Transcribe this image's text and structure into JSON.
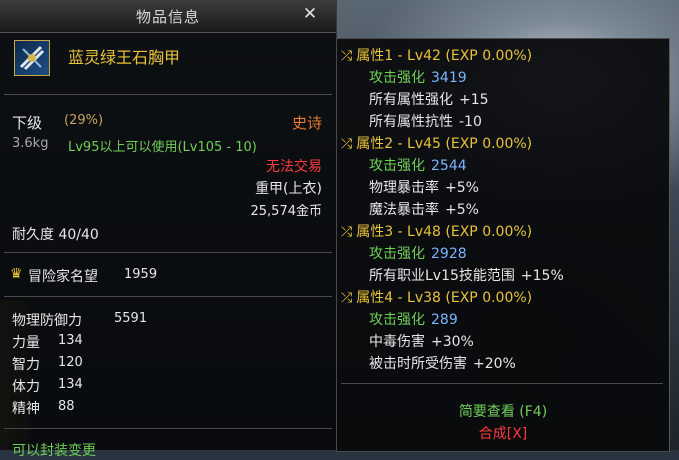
{
  "window": {
    "title": "物品信息"
  },
  "item": {
    "name": "蓝灵绿王石胸甲",
    "grade": "下级",
    "grade_percent": "(29%)",
    "rarity": "史诗",
    "weight": "3.6kg",
    "requirement": "Lv95以上可以使用(Lv105 - 10)",
    "trade": "无法交易",
    "type": "重甲(上衣)",
    "price": "25,574金币",
    "durability": "耐久度 40/40",
    "adventurer_fame_label": "冒险家名望",
    "adventurer_fame_value": "1959",
    "stats": [
      {
        "label": "物理防御力",
        "value": "5591"
      },
      {
        "label": "力量",
        "value": "134"
      },
      {
        "label": "智力",
        "value": "120"
      },
      {
        "label": "体力",
        "value": "134"
      },
      {
        "label": "精神",
        "value": "88"
      }
    ],
    "footer_cut": "可以封装变更"
  },
  "attributes": [
    {
      "header": "属性1 - Lv42 (EXP 0.00%)",
      "lines": [
        {
          "label": "攻击强化",
          "value": "3419",
          "label_color": "green",
          "value_color": "blue"
        },
        {
          "label": "所有属性强化",
          "value": "+15",
          "label_color": "white",
          "value_color": "white"
        },
        {
          "label": "所有属性抗性",
          "value": "-10",
          "label_color": "white",
          "value_color": "white"
        }
      ]
    },
    {
      "header": "属性2 - Lv45 (EXP 0.00%)",
      "lines": [
        {
          "label": "攻击强化",
          "value": "2544",
          "label_color": "green",
          "value_color": "blue"
        },
        {
          "label": "物理暴击率",
          "value": "+5%",
          "label_color": "white",
          "value_color": "white"
        },
        {
          "label": "魔法暴击率",
          "value": "+5%",
          "label_color": "white",
          "value_color": "white"
        }
      ]
    },
    {
      "header": "属性3 - Lv48 (EXP 0.00%)",
      "lines": [
        {
          "label": "攻击强化",
          "value": "2928",
          "label_color": "green",
          "value_color": "blue"
        },
        {
          "label": "所有职业Lv15技能范围",
          "value": "+15%",
          "label_color": "white",
          "value_color": "white"
        }
      ]
    },
    {
      "header": "属性4 - Lv38 (EXP 0.00%)",
      "lines": [
        {
          "label": "攻击强化",
          "value": "289",
          "label_color": "green",
          "value_color": "blue"
        },
        {
          "label": "中毒伤害",
          "value": "+30%",
          "label_color": "white",
          "value_color": "white"
        },
        {
          "label": "被击时所受伤害",
          "value": "+20%",
          "label_color": "white",
          "value_color": "white"
        }
      ]
    }
  ],
  "actions": {
    "brief_view": "简要查看 (F4)",
    "synthesis": "合成[X]"
  },
  "colors": {
    "gold": "#e8c23a",
    "green": "#6fcf58",
    "blue": "#7ab4ff",
    "red": "#ff3a3a",
    "orange": "#e87a2c"
  }
}
